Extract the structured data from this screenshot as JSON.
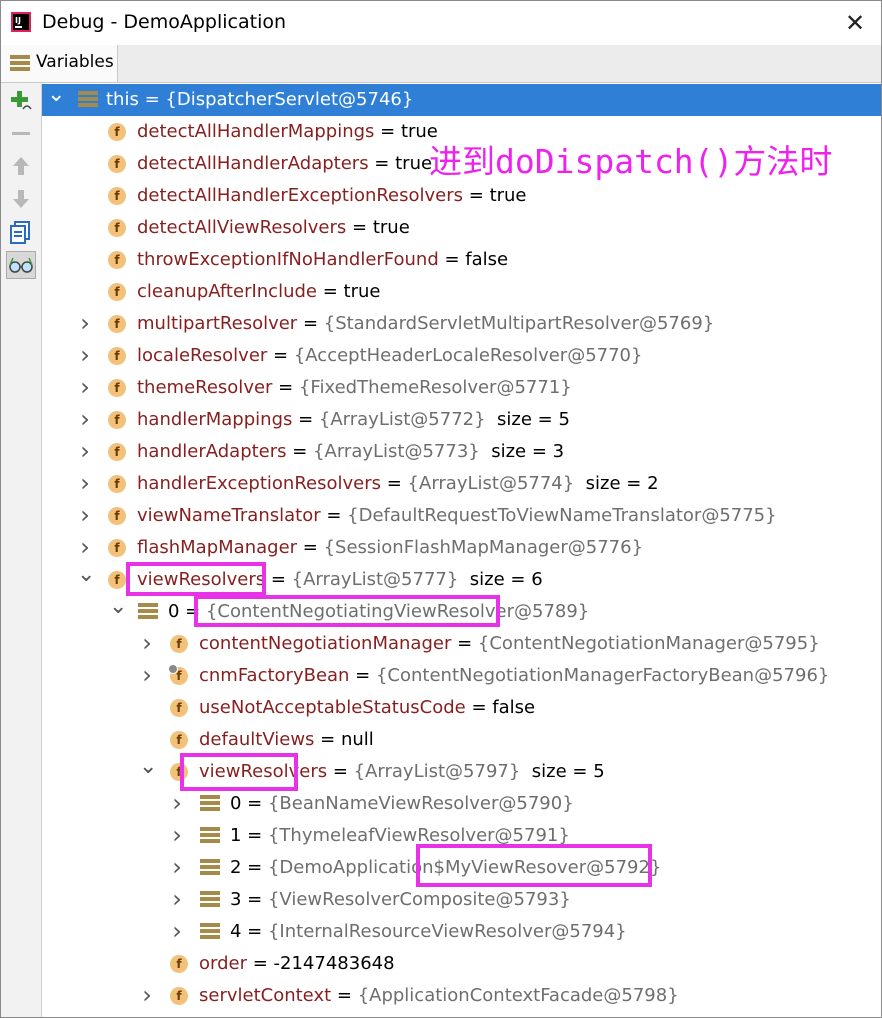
{
  "window": {
    "title": "Debug - DemoApplication"
  },
  "tab": {
    "label": "Variables"
  },
  "toolbar": {
    "icons": [
      "add-watch-icon",
      "remove-icon",
      "up-icon",
      "down-icon",
      "copy-icon",
      "glasses-icon"
    ]
  },
  "annotation": {
    "text": "进到doDispatch()方法时"
  },
  "rows": [
    {
      "name": "this",
      "eq": " = ",
      "ref": "{DispatcherServlet@5746}"
    },
    {
      "name": "detectAllHandlerMappings",
      "eq": " = ",
      "val": "true"
    },
    {
      "name": "detectAllHandlerAdapters",
      "eq": " = ",
      "val": "true"
    },
    {
      "name": "detectAllHandlerExceptionResolvers",
      "eq": " = ",
      "val": "true"
    },
    {
      "name": "detectAllViewResolvers",
      "eq": " = ",
      "val": "true"
    },
    {
      "name": "throwExceptionIfNoHandlerFound",
      "eq": " = ",
      "val": "false"
    },
    {
      "name": "cleanupAfterInclude",
      "eq": " = ",
      "val": "true"
    },
    {
      "name": "multipartResolver",
      "eq": " = ",
      "ref": "{StandardServletMultipartResolver@5769}"
    },
    {
      "name": "localeResolver",
      "eq": " = ",
      "ref": "{AcceptHeaderLocaleResolver@5770}"
    },
    {
      "name": "themeResolver",
      "eq": " = ",
      "ref": "{FixedThemeResolver@5771}"
    },
    {
      "name": "handlerMappings",
      "eq": " = ",
      "ref": "{ArrayList@5772}",
      "extra": "  size = 5"
    },
    {
      "name": "handlerAdapters",
      "eq": " = ",
      "ref": "{ArrayList@5773}",
      "extra": "  size = 3"
    },
    {
      "name": "handlerExceptionResolvers",
      "eq": " = ",
      "ref": "{ArrayList@5774}",
      "extra": "  size = 2"
    },
    {
      "name": "viewNameTranslator",
      "eq": " = ",
      "ref": "{DefaultRequestToViewNameTranslator@5775}"
    },
    {
      "name": "flashMapManager",
      "eq": " = ",
      "ref": "{SessionFlashMapManager@5776}"
    },
    {
      "name": "viewResolvers",
      "eq": " = ",
      "ref": "{ArrayList@5777}",
      "extra": "  size = 6"
    },
    {
      "name": "0",
      "eq": " = ",
      "ref": "{ContentNegotiatingViewResolver@5789}"
    },
    {
      "name": "contentNegotiationManager",
      "eq": " = ",
      "ref": "{ContentNegotiationManager@5795}"
    },
    {
      "name": "cnmFactoryBean",
      "eq": " = ",
      "ref": "{ContentNegotiationManagerFactoryBean@5796}"
    },
    {
      "name": "useNotAcceptableStatusCode",
      "eq": " = ",
      "val": "false"
    },
    {
      "name": "defaultViews",
      "eq": " = ",
      "val": "null"
    },
    {
      "name": "viewResolvers",
      "eq": " = ",
      "ref": "{ArrayList@5797}",
      "extra": "  size = 5"
    },
    {
      "name": "0",
      "eq": " = ",
      "ref": "{BeanNameViewResolver@5790}"
    },
    {
      "name": "1",
      "eq": " = ",
      "ref": "{ThymeleafViewResolver@5791}"
    },
    {
      "name": "2",
      "eq": " = ",
      "ref": "{DemoApplication$MyViewResover@5792}"
    },
    {
      "name": "3",
      "eq": " = ",
      "ref": "{ViewResolverComposite@5793}"
    },
    {
      "name": "4",
      "eq": " = ",
      "ref": "{InternalResourceViewResolver@5794}"
    },
    {
      "name": "order",
      "eq": " = ",
      "val": "-2147483648"
    },
    {
      "name": "servletContext",
      "eq": " = ",
      "ref": "{ApplicationContextFacade@5798}"
    }
  ]
}
